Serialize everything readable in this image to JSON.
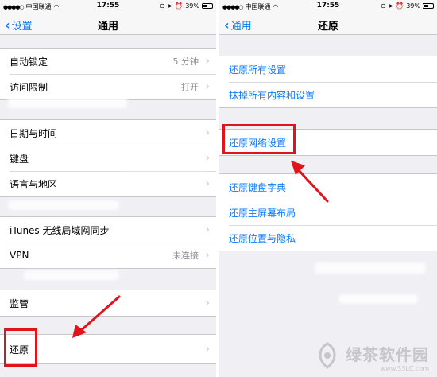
{
  "left_screen": {
    "statusbar": {
      "carrier": "中国联通",
      "time": "17:55",
      "battery": "39%"
    },
    "navbar": {
      "back_label": "设置",
      "title": "通用"
    },
    "group1": [
      {
        "label": "自动锁定",
        "value": "5 分钟"
      },
      {
        "label": "访问限制",
        "value": "打开"
      }
    ],
    "group2": [
      {
        "label": "日期与时间"
      },
      {
        "label": "键盘"
      },
      {
        "label": "语言与地区"
      }
    ],
    "group3": [
      {
        "label": "iTunes 无线局域网同步"
      },
      {
        "label": "VPN",
        "value": "未连接"
      }
    ],
    "group4": [
      {
        "label": "监管"
      }
    ],
    "group5": [
      {
        "label": "还原"
      }
    ]
  },
  "right_screen": {
    "statusbar": {
      "carrier": "中国联通",
      "time": "17:55",
      "battery": "39%"
    },
    "navbar": {
      "back_label": "通用",
      "title": "还原"
    },
    "group1": [
      {
        "label": "还原所有设置"
      },
      {
        "label": "抹掉所有内容和设置"
      }
    ],
    "group2": [
      {
        "label": "还原网络设置"
      }
    ],
    "group3": [
      {
        "label": "还原键盘字典"
      },
      {
        "label": "还原主屏幕布局"
      },
      {
        "label": "还原位置与隐私"
      }
    ]
  },
  "watermark": {
    "brand": "绿茶软件园",
    "url": "www.33LC.com"
  },
  "colors": {
    "accent": "#0a7aff",
    "highlight": "#e0141a",
    "background": "#efeff4"
  }
}
